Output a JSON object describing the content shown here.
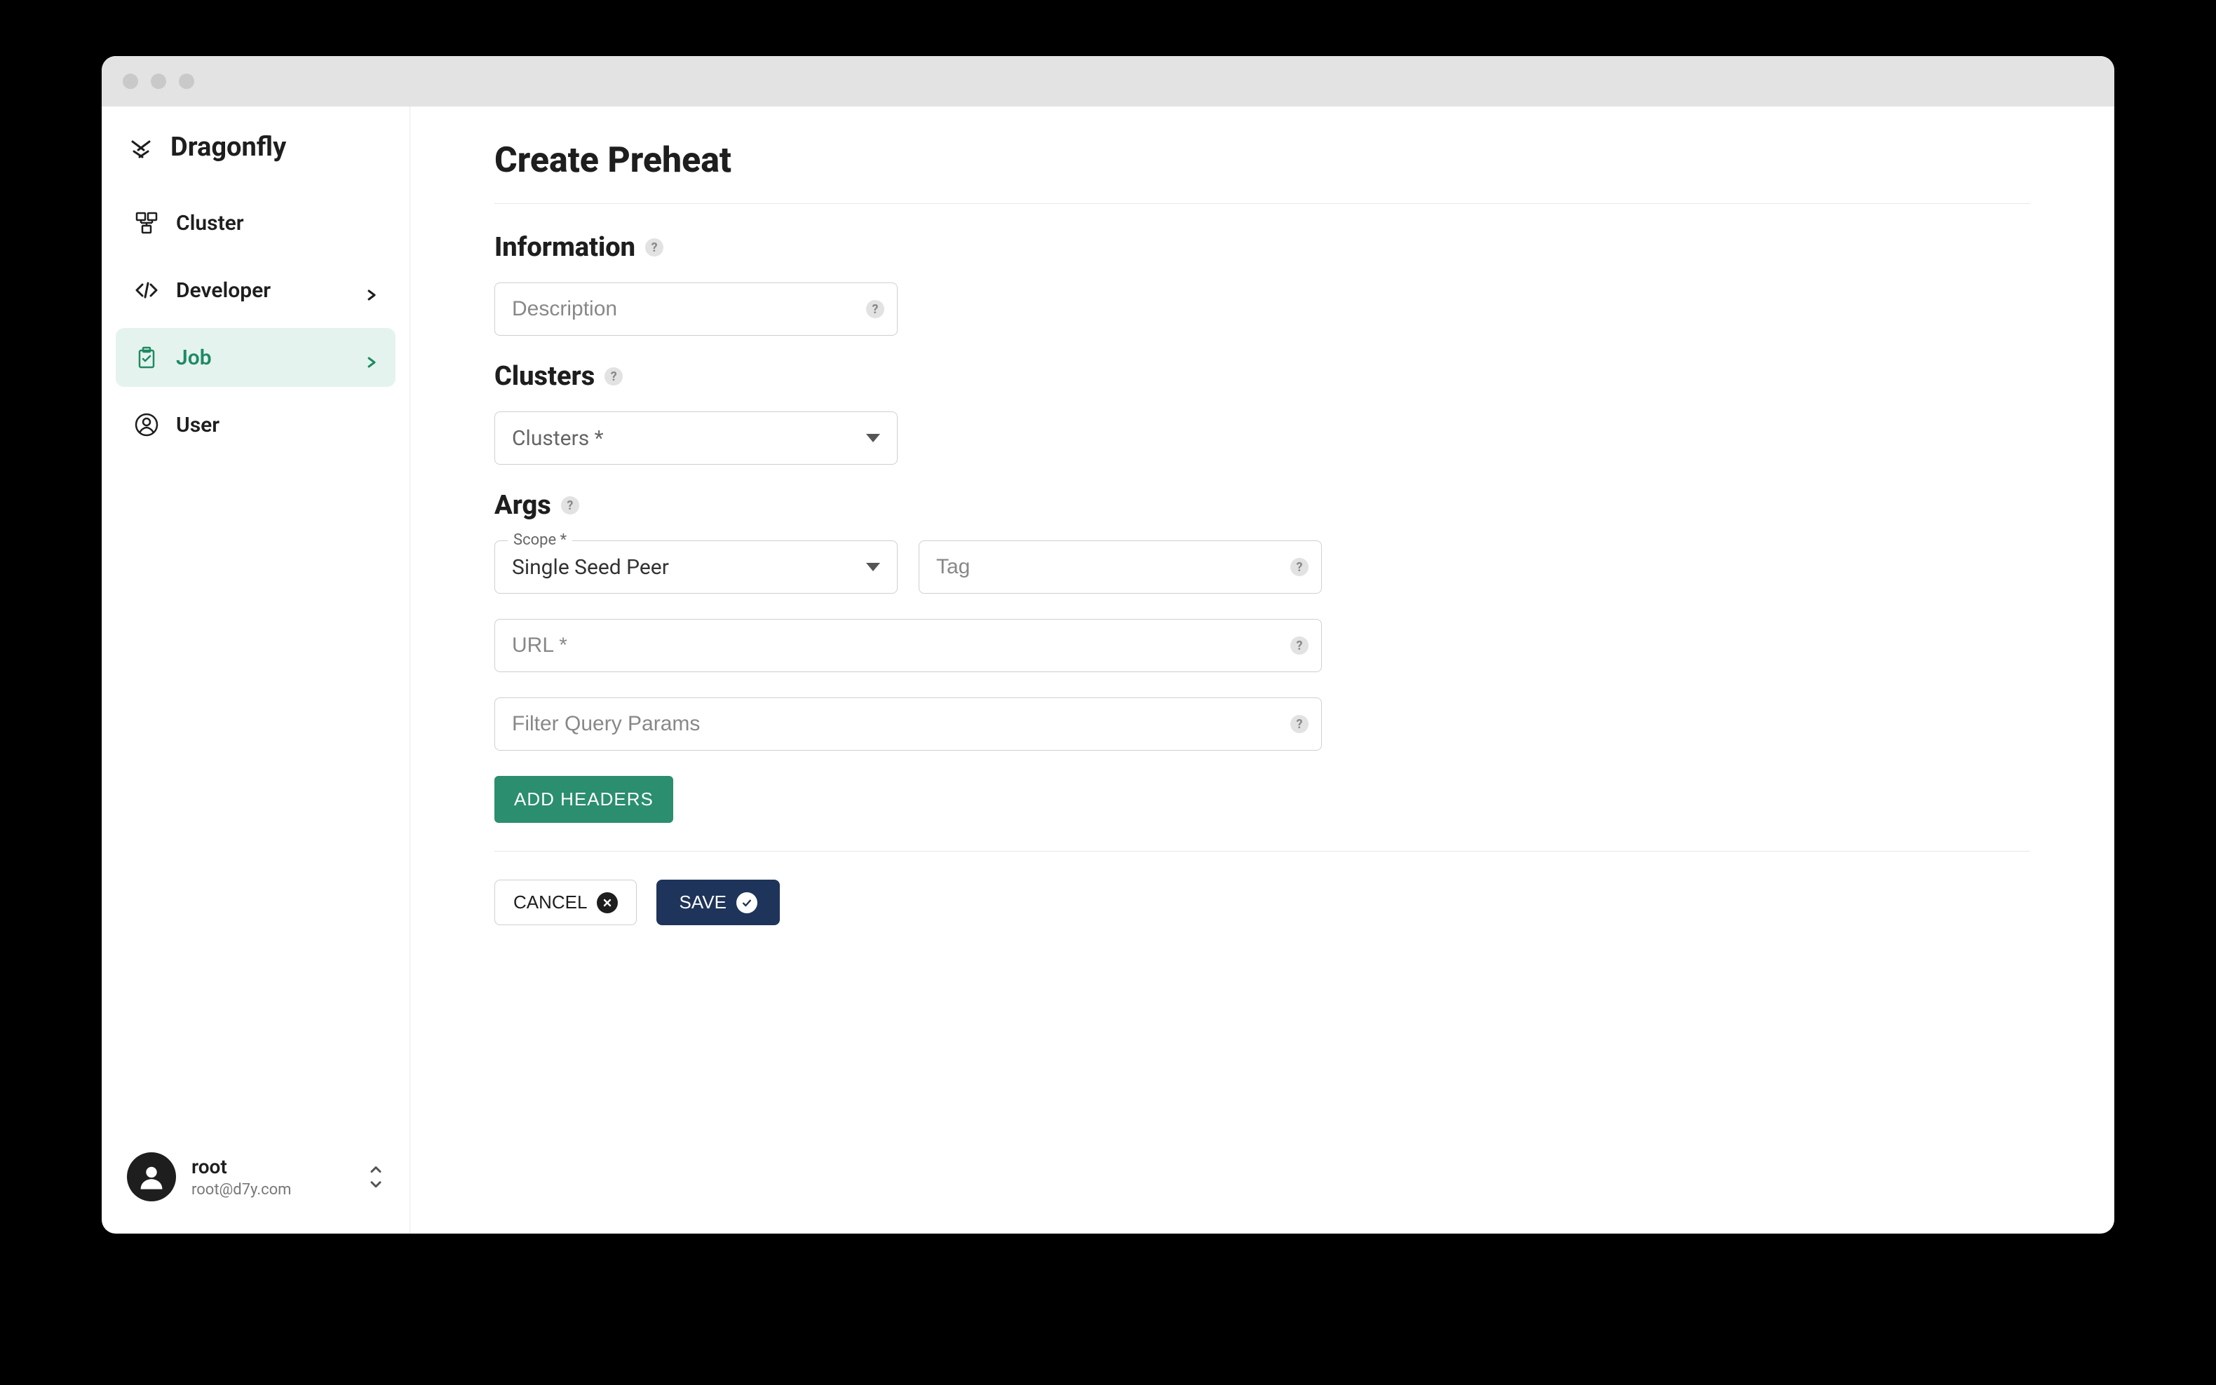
{
  "brand": {
    "name": "Dragonfly"
  },
  "sidebar": {
    "items": [
      {
        "label": "Cluster",
        "icon": "cluster-icon",
        "expandable": false
      },
      {
        "label": "Developer",
        "icon": "code-icon",
        "expandable": true
      },
      {
        "label": "Job",
        "icon": "job-icon",
        "expandable": true,
        "active": true
      },
      {
        "label": "User",
        "icon": "user-icon",
        "expandable": false
      }
    ]
  },
  "user": {
    "name": "root",
    "email": "root@d7y.com"
  },
  "page": {
    "title": "Create Preheat",
    "sections": {
      "information": {
        "title": "Information",
        "description_placeholder": "Description"
      },
      "clusters": {
        "title": "Clusters",
        "placeholder": "Clusters *"
      },
      "args": {
        "title": "Args",
        "scope_label": "Scope *",
        "scope_value": "Single Seed Peer",
        "tag_placeholder": "Tag",
        "url_placeholder": "URL *",
        "filter_placeholder": "Filter Query Params",
        "add_headers_label": "ADD HEADERS"
      }
    },
    "actions": {
      "cancel": "CANCEL",
      "save": "SAVE"
    }
  }
}
